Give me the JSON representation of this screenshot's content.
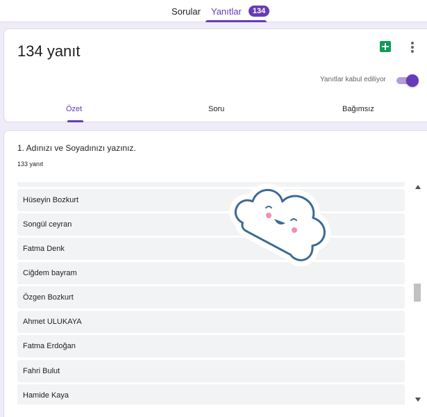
{
  "top_tabs": {
    "questions_label": "Sorular",
    "responses_label": "Yanıtlar",
    "responses_badge": "134"
  },
  "summary": {
    "response_count_label": "134 yanıt",
    "accepting_label": "Yanıtlar kabul ediliyor",
    "accepting_on": true,
    "sub_tabs": [
      "Özet",
      "Soru",
      "Bağımsız"
    ],
    "active_sub_tab": "Özet"
  },
  "question": {
    "title": "1. Adınızı ve Soyadınızı yazınız.",
    "count_label": "133 yanıt",
    "answers": [
      "Hüseyin Bozkurt",
      "Songül ceyran",
      "Fatma Denk",
      "Ciğdem bayram",
      "Özgen Bozkurt",
      "Ahmet ULUKAYA",
      "Fatma Erdoğan",
      "Fahri Bulut",
      "Hamide Kaya"
    ]
  },
  "colors": {
    "accent": "#673ab7",
    "background": "#f0ebf8",
    "sheets_green": "#0f9d58",
    "list_bg": "#f1f3f4"
  },
  "icons": {
    "sheets": "google-sheets-icon",
    "more": "more-vert-icon",
    "sticker": "cloud-sticker"
  }
}
